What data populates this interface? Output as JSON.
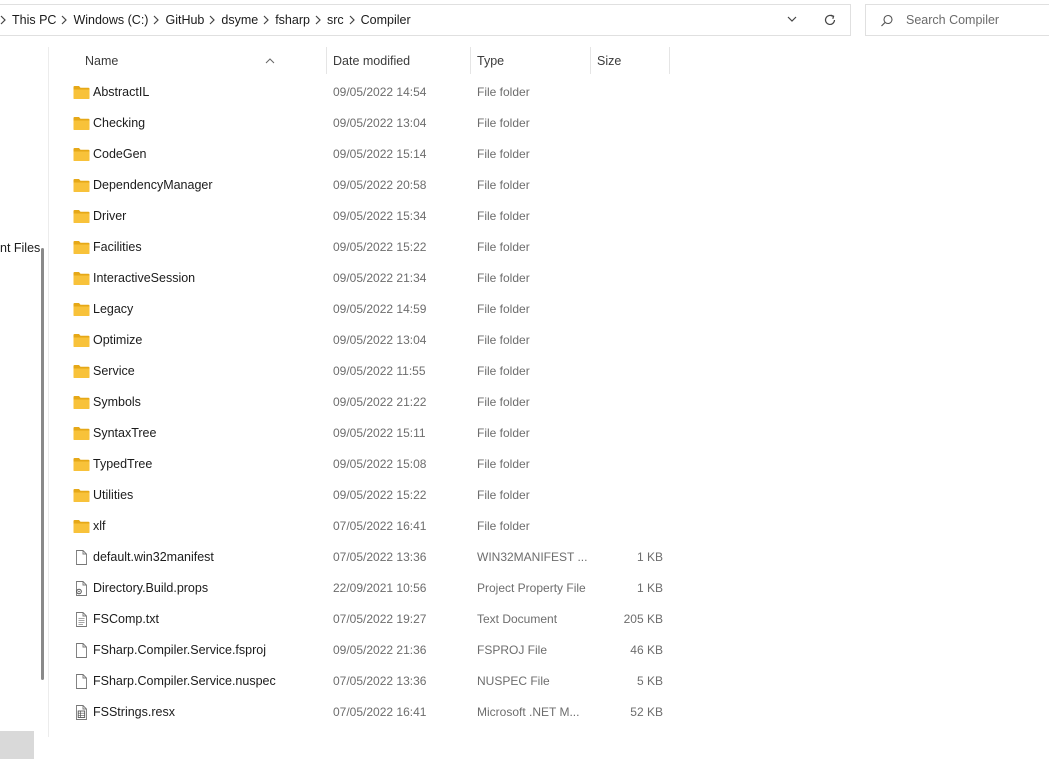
{
  "breadcrumb": [
    "This PC",
    "Windows (C:)",
    "GitHub",
    "dsyme",
    "fsharp",
    "src",
    "Compiler"
  ],
  "search": {
    "placeholder": "Search Compiler"
  },
  "nav": {
    "partial_label": "nt Files"
  },
  "columns": {
    "name": "Name",
    "date": "Date modified",
    "type": "Type",
    "size": "Size"
  },
  "files": [
    {
      "name": "AbstractIL",
      "date": "09/05/2022 14:54",
      "type": "File folder",
      "size": "",
      "icon": "folder-icon"
    },
    {
      "name": "Checking",
      "date": "09/05/2022 13:04",
      "type": "File folder",
      "size": "",
      "icon": "folder-icon"
    },
    {
      "name": "CodeGen",
      "date": "09/05/2022 15:14",
      "type": "File folder",
      "size": "",
      "icon": "folder-icon"
    },
    {
      "name": "DependencyManager",
      "date": "09/05/2022 20:58",
      "type": "File folder",
      "size": "",
      "icon": "folder-icon"
    },
    {
      "name": "Driver",
      "date": "09/05/2022 15:34",
      "type": "File folder",
      "size": "",
      "icon": "folder-icon"
    },
    {
      "name": "Facilities",
      "date": "09/05/2022 15:22",
      "type": "File folder",
      "size": "",
      "icon": "folder-icon"
    },
    {
      "name": "InteractiveSession",
      "date": "09/05/2022 21:34",
      "type": "File folder",
      "size": "",
      "icon": "folder-icon"
    },
    {
      "name": "Legacy",
      "date": "09/05/2022 14:59",
      "type": "File folder",
      "size": "",
      "icon": "folder-icon"
    },
    {
      "name": "Optimize",
      "date": "09/05/2022 13:04",
      "type": "File folder",
      "size": "",
      "icon": "folder-icon"
    },
    {
      "name": "Service",
      "date": "09/05/2022 11:55",
      "type": "File folder",
      "size": "",
      "icon": "folder-icon"
    },
    {
      "name": "Symbols",
      "date": "09/05/2022 21:22",
      "type": "File folder",
      "size": "",
      "icon": "folder-icon"
    },
    {
      "name": "SyntaxTree",
      "date": "09/05/2022 15:11",
      "type": "File folder",
      "size": "",
      "icon": "folder-icon"
    },
    {
      "name": "TypedTree",
      "date": "09/05/2022 15:08",
      "type": "File folder",
      "size": "",
      "icon": "folder-icon"
    },
    {
      "name": "Utilities",
      "date": "09/05/2022 15:22",
      "type": "File folder",
      "size": "",
      "icon": "folder-icon"
    },
    {
      "name": "xlf",
      "date": "07/05/2022 16:41",
      "type": "File folder",
      "size": "",
      "icon": "folder-icon"
    },
    {
      "name": "default.win32manifest",
      "date": "07/05/2022 13:36",
      "type": "WIN32MANIFEST ...",
      "size": "1 KB",
      "icon": "file-icon"
    },
    {
      "name": "Directory.Build.props",
      "date": "22/09/2021 10:56",
      "type": "Project Property File",
      "size": "1 KB",
      "icon": "props-file-icon"
    },
    {
      "name": "FSComp.txt",
      "date": "07/05/2022 19:27",
      "type": "Text Document",
      "size": "205 KB",
      "icon": "text-file-icon"
    },
    {
      "name": "FSharp.Compiler.Service.fsproj",
      "date": "09/05/2022 21:36",
      "type": "FSPROJ File",
      "size": "46 KB",
      "icon": "file-icon"
    },
    {
      "name": "FSharp.Compiler.Service.nuspec",
      "date": "07/05/2022 13:36",
      "type": "NUSPEC File",
      "size": "5 KB",
      "icon": "file-icon"
    },
    {
      "name": "FSStrings.resx",
      "date": "07/05/2022 16:41",
      "type": "Microsoft .NET M...",
      "size": "52 KB",
      "icon": "resx-file-icon"
    }
  ],
  "colors": {
    "folder": "#f8c23a",
    "folder_dark": "#e6a817"
  }
}
